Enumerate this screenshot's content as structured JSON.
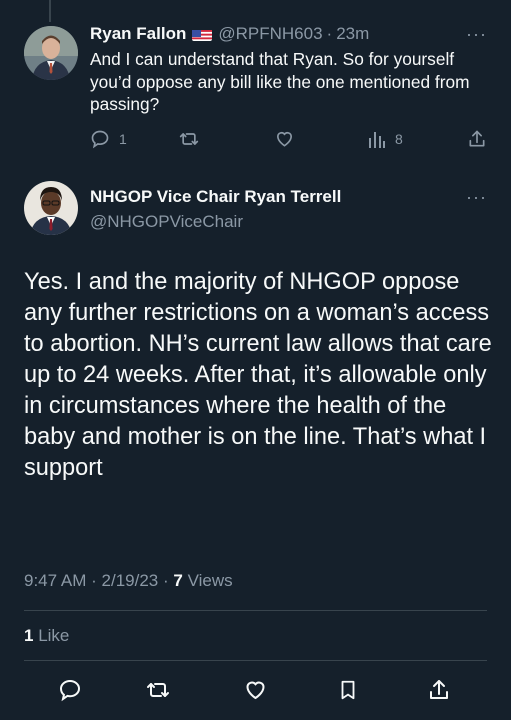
{
  "reply": {
    "author_name": "Ryan Fallon",
    "flag_icon": "us-flag-icon",
    "handle": "@RPFNH603",
    "separator": "·",
    "time": "23m",
    "more": "···",
    "text": "And I can understand that Ryan. So for yourself you’d oppose any bill like the one mentioned from passing?",
    "reply_count": "1",
    "views_count": "8"
  },
  "tweet": {
    "author_name": "NHGOP Vice Chair Ryan Terrell",
    "handle": "@NHGOPViceChair",
    "more": "···",
    "text": "Yes. I and the majority of NHGOP oppose any further restrictions on a woman’s access to abortion. NH’s current law allows that care up to 24 weeks. After that, it’s allowable only in circumstances where the health of the baby and mother is on the line. That’s what I support",
    "time": "9:47 AM",
    "date": "2/19/23",
    "dot": "·",
    "views_count": "7",
    "views_label": "Views",
    "likes_count": "1",
    "likes_label": "Like"
  },
  "colors": {
    "background": "#15202b",
    "text": "#f7f9f9",
    "muted": "#8b98a5",
    "divider": "#38444d"
  }
}
